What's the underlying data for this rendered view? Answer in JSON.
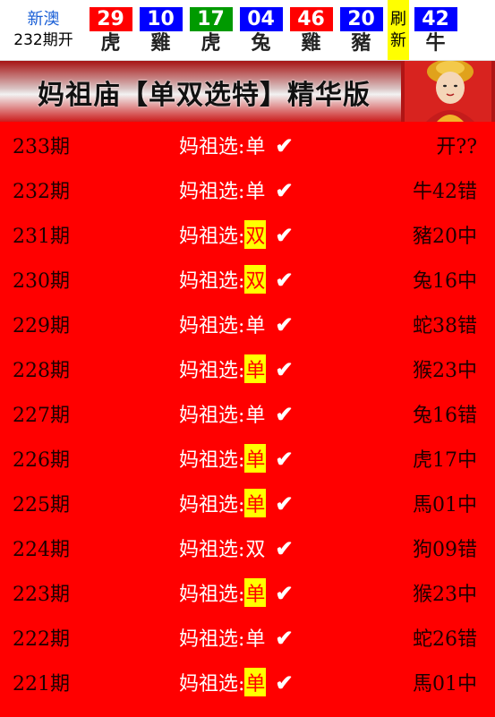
{
  "issue": {
    "region": "新澳",
    "period": "232期开"
  },
  "balls": [
    {
      "num": "29",
      "zodiac": "虎",
      "color": "#ff0000"
    },
    {
      "num": "10",
      "zodiac": "雞",
      "color": "#0000ff"
    },
    {
      "num": "17",
      "zodiac": "虎",
      "color": "#009a00"
    },
    {
      "num": "04",
      "zodiac": "兔",
      "color": "#0000ff"
    },
    {
      "num": "46",
      "zodiac": "雞",
      "color": "#ff0000"
    },
    {
      "num": "20",
      "zodiac": "豬",
      "color": "#0000ff"
    }
  ],
  "refresh": {
    "line1": "刷",
    "line2": "新"
  },
  "special": {
    "num": "42",
    "zodiac": "牛",
    "color": "#0000ff"
  },
  "banner": {
    "title": "妈祖庙【单双选特】精华版"
  },
  "rows": [
    {
      "period": "233期",
      "label": "妈祖选:",
      "value": "单",
      "highlight": false,
      "result": "开??"
    },
    {
      "period": "232期",
      "label": "妈祖选:",
      "value": "单",
      "highlight": false,
      "result": "牛42错"
    },
    {
      "period": "231期",
      "label": "妈祖选:",
      "value": "双",
      "highlight": true,
      "result": "豬20中"
    },
    {
      "period": "230期",
      "label": "妈祖选:",
      "value": "双",
      "highlight": true,
      "result": "兔16中"
    },
    {
      "period": "229期",
      "label": "妈祖选:",
      "value": "单",
      "highlight": false,
      "result": "蛇38错"
    },
    {
      "period": "228期",
      "label": "妈祖选:",
      "value": "单",
      "highlight": true,
      "result": "猴23中"
    },
    {
      "period": "227期",
      "label": "妈祖选:",
      "value": "单",
      "highlight": false,
      "result": "兔16错"
    },
    {
      "period": "226期",
      "label": "妈祖选:",
      "value": "单",
      "highlight": true,
      "result": "虎17中"
    },
    {
      "period": "225期",
      "label": "妈祖选:",
      "value": "单",
      "highlight": true,
      "result": "馬01中"
    },
    {
      "period": "224期",
      "label": "妈祖选:",
      "value": "双",
      "highlight": false,
      "result": "狗09错"
    },
    {
      "period": "223期",
      "label": "妈祖选:",
      "value": "单",
      "highlight": true,
      "result": "猴23中"
    },
    {
      "period": "222期",
      "label": "妈祖选:",
      "value": "单",
      "highlight": false,
      "result": "蛇26错"
    },
    {
      "period": "221期",
      "label": "妈祖选:",
      "value": "单",
      "highlight": true,
      "result": "馬01中"
    }
  ],
  "check_mark": "✔",
  "colors": {
    "list_bg": "#ff0000",
    "highlight": "#ffff00",
    "refresh_bg": "#ffff00"
  }
}
